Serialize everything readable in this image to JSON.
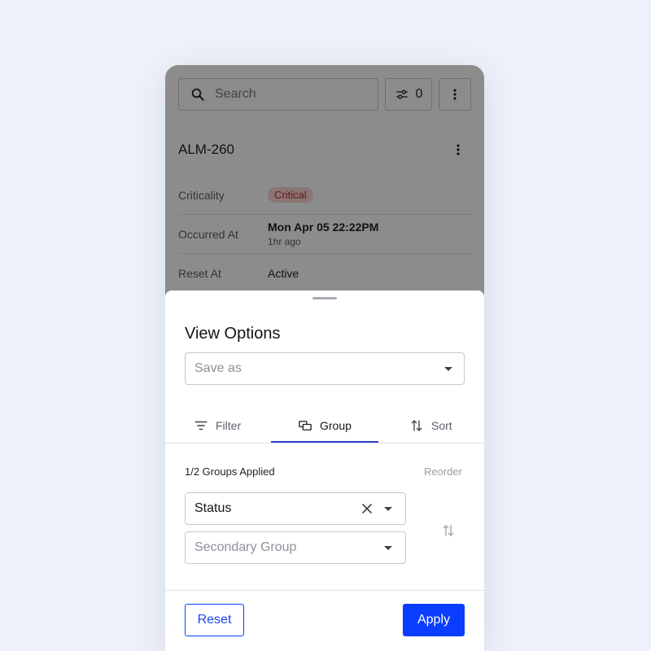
{
  "background_screen": {
    "search": {
      "placeholder": "Search",
      "icon": "search-icon"
    },
    "filter_button": {
      "count": "0",
      "icon": "sliders-icon"
    },
    "more_button": {
      "icon": "more-vertical-icon"
    },
    "alarm": {
      "id": "ALM-260",
      "more_icon": "more-vertical-icon",
      "details": [
        {
          "label": "Criticality",
          "value": "Critical"
        },
        {
          "label": "Occurred At",
          "value": "Mon Apr 05 22:22PM",
          "sub": "1hr ago"
        },
        {
          "label": "Reset At",
          "value": "Active"
        }
      ]
    }
  },
  "sheet": {
    "title": "View Options",
    "save_as": {
      "placeholder": "Save as"
    },
    "tabs": [
      {
        "label": "Filter",
        "icon": "filter-lines-icon",
        "active": false
      },
      {
        "label": "Group",
        "icon": "group-icon",
        "active": true
      },
      {
        "label": "Sort",
        "icon": "sort-arrows-icon",
        "active": false
      }
    ],
    "groups_applied": "1/2 Groups Applied",
    "reorder_label": "Reorder",
    "primary_group": {
      "value": "Status"
    },
    "secondary_group": {
      "placeholder": "Secondary Group"
    },
    "footer": {
      "reset_label": "Reset",
      "apply_label": "Apply"
    }
  },
  "colors": {
    "accent": "#0a3dff",
    "tab_underline": "#2f3fc4",
    "badge_bg": "#fbd5d5",
    "badge_text": "#c42b2b",
    "page_bg": "#edf1f9"
  }
}
